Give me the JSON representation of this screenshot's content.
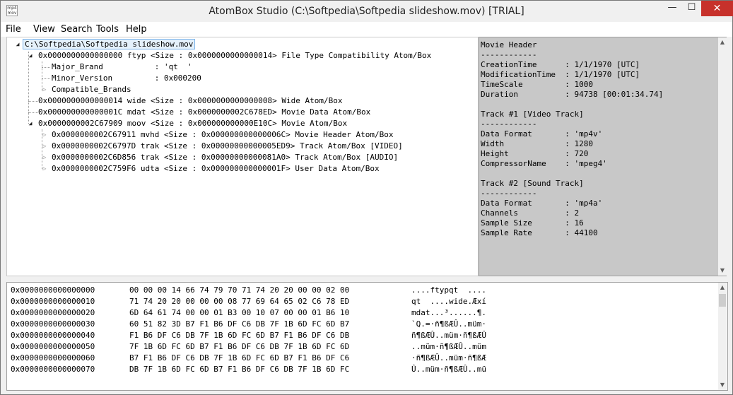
{
  "window": {
    "title": "AtomBox Studio (C:\\Softpedia\\Softpedia slideshow.mov) [TRIAL]",
    "icon_label": "mp4 mov",
    "minimize": "—",
    "maximize": "☐",
    "close": "✕"
  },
  "menu": [
    "File",
    "View",
    "Search",
    "Tools",
    "Help"
  ],
  "tree": {
    "root": "C:\\Softpedia\\Softpedia slideshow.mov",
    "ftyp": "0x0000000000000000 ftyp <Size : 0x0000000000000014> File Type Compatibility Atom/Box",
    "major_brand": "Major_Brand           : 'qt  '",
    "minor_version": "Minor_Version         : 0x000200",
    "compatible_brands": "Compatible_Brands",
    "wide": "0x0000000000000014 wide <Size : 0x0000000000000008> Wide Atom/Box",
    "mdat": "0x000000000000001C mdat <Size : 0x0000000002C678ED> Movie Data Atom/Box",
    "moov": "0x0000000002C67909 moov <Size : 0x000000000000E10C> Movie Atom/Box",
    "mvhd": "0x0000000002C67911 mvhd <Size : 0x000000000000006C> Movie Header Atom/Box",
    "trak_video": "0x0000000002C6797D trak <Size : 0x00000000000005ED9> Track Atom/Box [VIDEO]",
    "trak_audio": "0x0000000002C6D856 trak <Size : 0x00000000000081A0> Track Atom/Box [AUDIO]",
    "udta": "0x0000000002C759F6 udta <Size : 0x000000000000001F> User Data Atom/Box"
  },
  "info": [
    "Movie Header",
    "------------",
    "CreationTime      : 1/1/1970 [UTC]",
    "ModificationTime  : 1/1/1970 [UTC]",
    "TimeScale         : 1000",
    "Duration          : 94738 [00:01:34.74]",
    "",
    "Track #1 [Video Track]",
    "------------",
    "Data Format       : 'mp4v'",
    "Width             : 1280",
    "Height            : 720",
    "CompressorName    : 'mpeg4'",
    "",
    "Track #2 [Sound Track]",
    "------------",
    "Data Format       : 'mp4a'",
    "Channels          : 2",
    "Sample Size       : 16",
    "Sample Rate       : 44100"
  ],
  "hex": [
    {
      "offset": "0x0000000000000000",
      "bytes": "00 00 00 14 66 74 79 70 71 74 20 20 00 00 02 00",
      "ascii": "....ftypqt  ...."
    },
    {
      "offset": "0x0000000000000010",
      "bytes": "71 74 20 20 00 00 00 08 77 69 64 65 02 C6 78 ED",
      "ascii": "qt  ....wide.Æxí"
    },
    {
      "offset": "0x0000000000000020",
      "bytes": "6D 64 61 74 00 00 01 B3 00 10 07 00 00 01 B6 10",
      "ascii": "mdat...³......¶."
    },
    {
      "offset": "0x0000000000000030",
      "bytes": "60 51 82 3D B7 F1 B6 DF C6 DB 7F 1B 6D FC 6D B7",
      "ascii": "`Q.=·ñ¶ßÆÛ..müm·"
    },
    {
      "offset": "0x0000000000000040",
      "bytes": "F1 B6 DF C6 DB 7F 1B 6D FC 6D B7 F1 B6 DF C6 DB",
      "ascii": "ñ¶ßÆÛ..müm·ñ¶ßÆÛ"
    },
    {
      "offset": "0x0000000000000050",
      "bytes": "7F 1B 6D FC 6D B7 F1 B6 DF C6 DB 7F 1B 6D FC 6D",
      "ascii": "..müm·ñ¶ßÆÛ..müm"
    },
    {
      "offset": "0x0000000000000060",
      "bytes": "B7 F1 B6 DF C6 DB 7F 1B 6D FC 6D B7 F1 B6 DF C6",
      "ascii": "·ñ¶ßÆÛ..müm·ñ¶ßÆ"
    },
    {
      "offset": "0x0000000000000070",
      "bytes": "DB 7F 1B 6D FC 6D B7 F1 B6 DF C6 DB 7F 1B 6D FC",
      "ascii": "Û..müm·ñ¶ßÆÛ..mü"
    }
  ],
  "colors": {
    "close_button": "#c7312b",
    "info_background": "#c8c8c8",
    "selection": "#e5f1fb"
  }
}
